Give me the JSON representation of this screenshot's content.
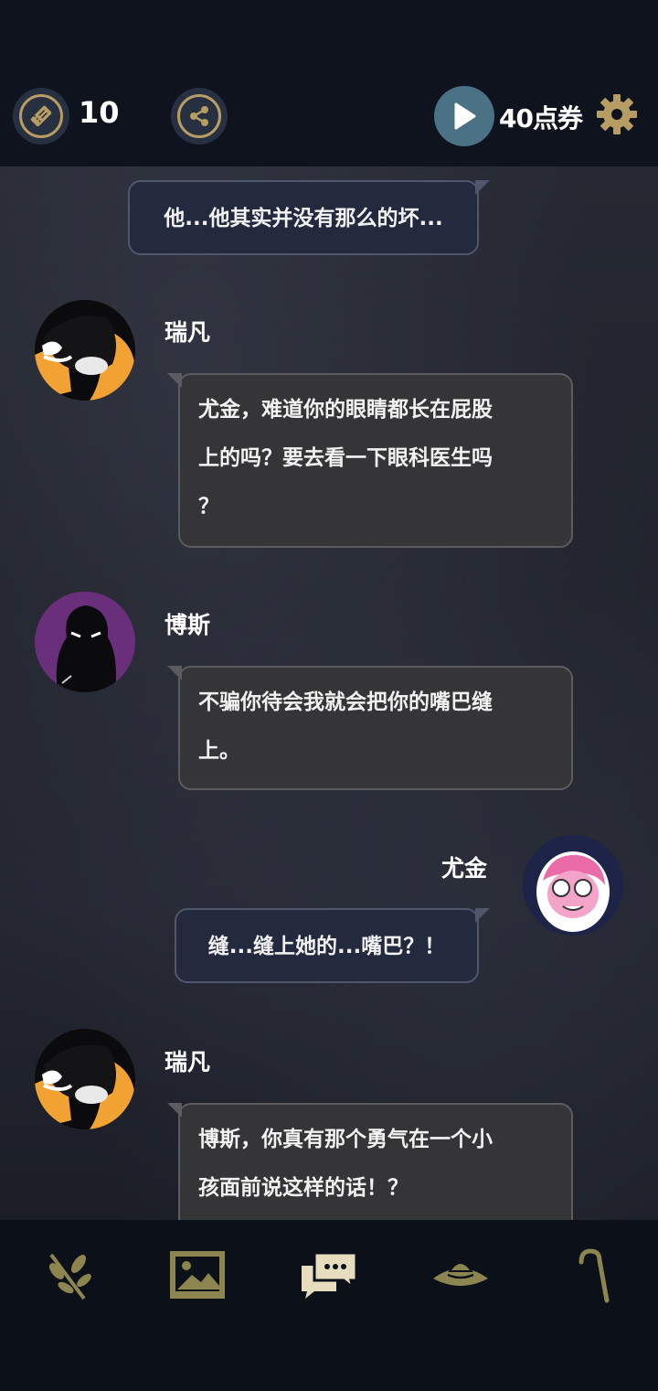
{
  "header": {
    "ticket_count": "10",
    "points_label": "40点券",
    "icons": {
      "ticket": "ticket-icon",
      "share": "share-icon",
      "play": "play-icon",
      "settings": "gear-icon"
    }
  },
  "messages": [
    {
      "type": "player",
      "text": "他...他其实并没有那么的坏..."
    },
    {
      "type": "other",
      "speaker": "瑞凡",
      "line1": "尤金，难道你的眼睛都长在屁股",
      "line2": "上的吗？要去看一下眼科医生吗",
      "line3": "？"
    },
    {
      "type": "other",
      "speaker": "博斯",
      "line1": "不骗你待会我就会把你的嘴巴缝",
      "line2": "上。"
    },
    {
      "type": "player",
      "speaker": "尤金",
      "text": "缝...缝上她的...嘴巴？！"
    },
    {
      "type": "other",
      "speaker": "瑞凡",
      "line1": "博斯，你真有那个勇气在一个小",
      "line2": "孩面前说这样的话！？"
    }
  ],
  "bottom_nav": {
    "items": [
      "sprig-icon",
      "gallery-icon",
      "chat-icon",
      "hat-icon",
      "cane-icon"
    ]
  },
  "colors": {
    "accent_gold": "#b79d63",
    "play_teal": "#4a7184",
    "nav_olive": "#8c8550",
    "nav_active": "#e5ddbe"
  }
}
